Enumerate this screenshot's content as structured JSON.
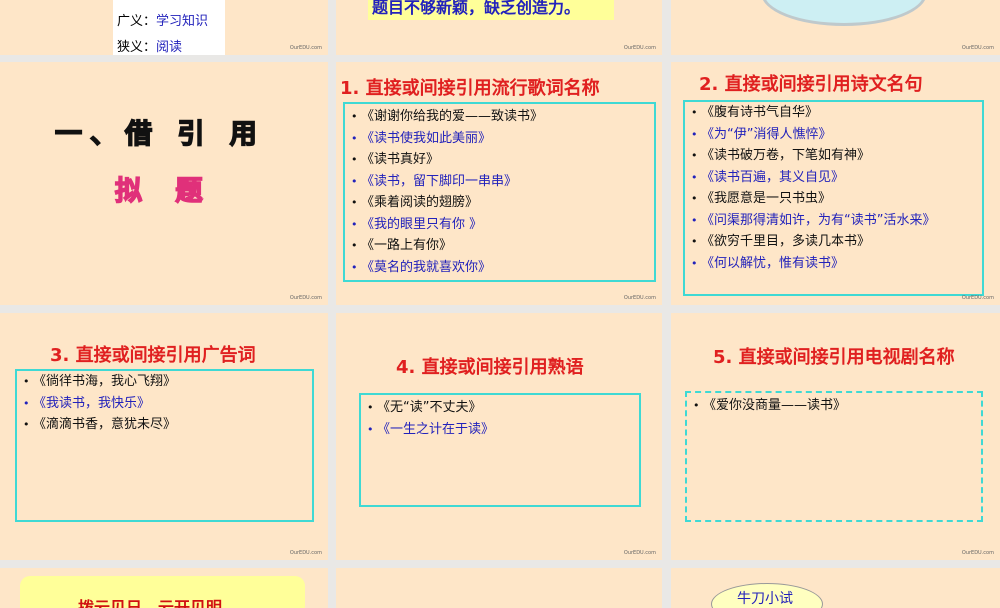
{
  "watermark": "OurEDU.com",
  "top_left": {
    "broad_label": "广义：",
    "broad_value": "学习知识",
    "narrow_label": "狭义：",
    "narrow_value": "阅读"
  },
  "top_mid": {
    "text": "题目不够新颖，缺乏创造力。"
  },
  "section_slide": {
    "heading": "一、借 引 用",
    "sub": "拟 题"
  },
  "slide1": {
    "title": "1. 直接或间接引用流行歌词名称",
    "items": [
      "《谢谢你给我的爱——致读书》",
      "《读书使我如此美丽》",
      "《读书真好》",
      "《读书，留下脚印一串串》",
      "《乘着阅读的翅膀》",
      "《我的眼里只有你 》",
      "《一路上有你》",
      "《莫名的我就喜欢你》"
    ]
  },
  "slide2": {
    "title": "2. 直接或间接引用诗文名句",
    "items": [
      "《腹有诗书气自华》",
      "《为“伊”消得人憔悴》",
      "《读书破万卷，下笔如有神》",
      "《读书百遍，其义自见》",
      "《我愿意是一只书虫》",
      "《问渠那得清如许，为有“读书”活水来》",
      "《欲穷千里目，多读几本书》",
      "《何以解忧，惟有读书》"
    ]
  },
  "slide3": {
    "title": "3. 直接或间接引用广告词",
    "items": [
      "《徜徉书海，我心飞翔》",
      "《我读书，我快乐》",
      "《滴滴书香，意犹未尽》"
    ]
  },
  "slide4": {
    "title": "4. 直接或间接引用熟语",
    "items": [
      "《无“读”不丈夫》",
      "《一生之计在于读》"
    ]
  },
  "slide5": {
    "title": "5. 直接或间接引用电视剧名称",
    "items": [
      "《爱你没商量——读书》"
    ]
  },
  "bottom_left": {
    "text": "拨云见日，云开见明"
  },
  "bottom_right": {
    "text": "牛刀小试"
  }
}
